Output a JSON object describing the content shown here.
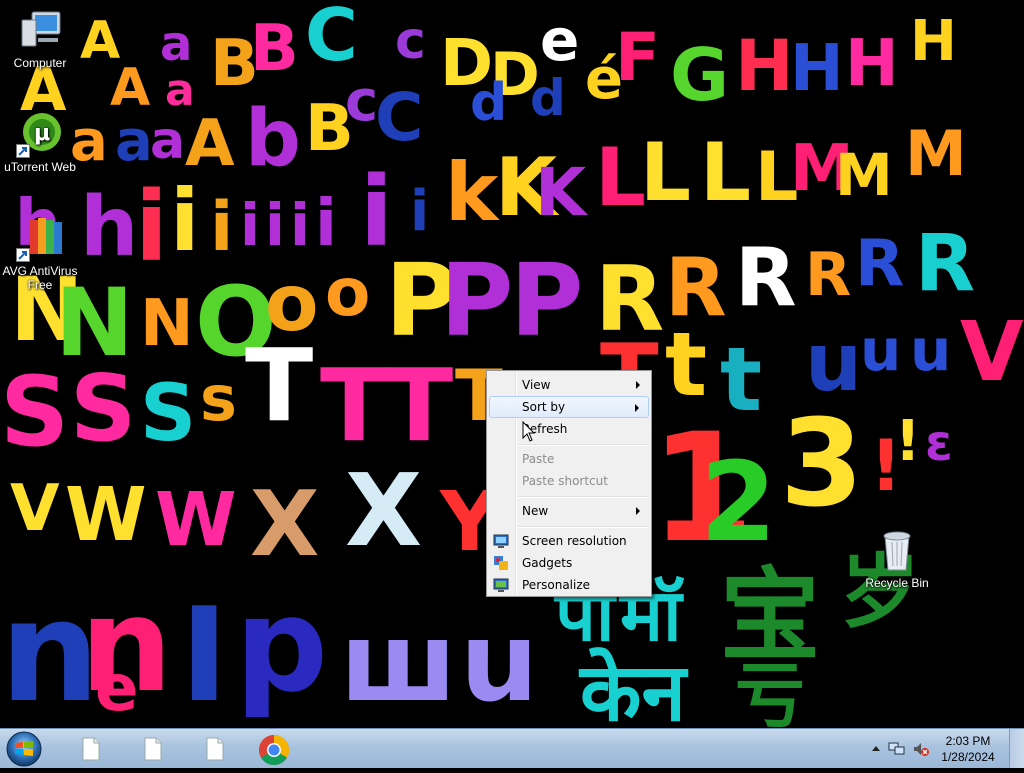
{
  "desktop": {
    "icons": [
      {
        "label": "Computer"
      },
      {
        "label": "uTorrent Web"
      },
      {
        "label": "AVG AntiVirus Free"
      },
      {
        "label": "Recycle Bin"
      }
    ]
  },
  "context_menu": {
    "items": [
      {
        "label": "View",
        "submenu": true,
        "enabled": true
      },
      {
        "label": "Sort by",
        "submenu": true,
        "enabled": true,
        "highlighted": true
      },
      {
        "label": "Refresh",
        "enabled": true
      },
      {
        "label": "Paste",
        "enabled": false
      },
      {
        "label": "Paste shortcut",
        "enabled": false
      },
      {
        "label": "New",
        "submenu": true,
        "enabled": true
      },
      {
        "label": "Screen resolution",
        "enabled": true,
        "icon": "screen-resolution-icon"
      },
      {
        "label": "Gadgets",
        "enabled": true,
        "icon": "gadgets-icon"
      },
      {
        "label": "Personalize",
        "enabled": true,
        "icon": "personalize-icon"
      }
    ]
  },
  "taskbar": {
    "pinned": [
      {
        "name": "document-1-icon"
      },
      {
        "name": "document-2-icon"
      },
      {
        "name": "document-3-icon"
      },
      {
        "name": "chrome-icon"
      }
    ],
    "clock": {
      "time": "2:03 PM",
      "date": "1/28/2024"
    }
  },
  "colors": {
    "wallpaper_bg": "#000000",
    "menu_bg": "#f0f0f0",
    "menu_highlight_border": "#aecff7",
    "taskbar_top": "#c9daec",
    "taskbar_bottom": "#9bb8d8"
  }
}
